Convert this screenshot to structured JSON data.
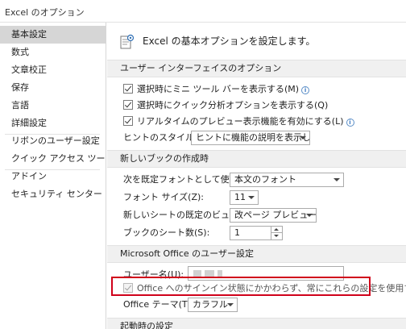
{
  "window": {
    "title": "Excel のオプション"
  },
  "sidebar": {
    "items": [
      {
        "label": "基本設定"
      },
      {
        "label": "数式"
      },
      {
        "label": "文章校正"
      },
      {
        "label": "保存"
      },
      {
        "label": "言語"
      },
      {
        "label": "詳細設定"
      },
      {
        "label": "リボンのユーザー設定"
      },
      {
        "label": "クイック アクセス ツール バー"
      },
      {
        "label": "アドイン"
      },
      {
        "label": "セキュリティ センター"
      }
    ]
  },
  "main": {
    "header": "Excel の基本オプションを設定します。",
    "sections": {
      "ui": "ユーザー インターフェイスのオプション",
      "new_workbook": "新しいブックの作成時",
      "office_user": "Microsoft Office のユーザー設定",
      "startup": "起動時の設定"
    },
    "ui_options": {
      "mini_toolbar": "選択時にミニ ツール バーを表示する(M)",
      "quick_analysis": "選択時にクイック分析オプションを表示する(Q)",
      "live_preview": "リアルタイムのプレビュー表示機能を有効にする(L)",
      "tooltip_style_label": "ヒントのスタイル(R):",
      "tooltip_style_value": "ヒントに機能の説明を表示しない"
    },
    "new_workbook": {
      "default_font_label": "次を既定フォントとして使用(N):",
      "default_font_value": "本文のフォント",
      "font_size_label": "フォント サイズ(Z):",
      "font_size_value": "11",
      "default_view_label": "新しいシートの既定のビュー(V):",
      "default_view_value": "改ページ プレビュー",
      "sheet_count_label": "ブックのシート数(S):",
      "sheet_count_value": "1"
    },
    "office_user": {
      "username_label": "ユーザー名(U):",
      "always_use_label": "Office へのサインイン状態にかかわらず、常にこれらの設定を使用する(A)",
      "theme_label": "Office テーマ(T):",
      "theme_value": "カラフル"
    }
  },
  "colors": {
    "highlight": "#d0021b",
    "section_bg": "#f0f0f0",
    "selected_nav": "#d6d6d6",
    "info_icon": "#3a78c2"
  },
  "icons": [
    "options-header-icon",
    "checkmark-icon",
    "info-icon",
    "dropdown-arrow-icon",
    "spinner-arrow-icon"
  ]
}
